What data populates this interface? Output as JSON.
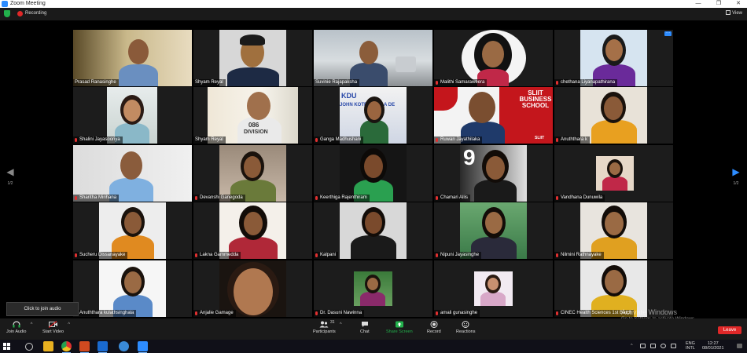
{
  "window": {
    "title": "Zoom Meeting"
  },
  "status": {
    "recording_label": "Recording",
    "view_label": "View"
  },
  "pager": {
    "prev_page": "1/2",
    "next_page": "1/2"
  },
  "participants": [
    {
      "name": "Prasad Ranasinghe"
    },
    {
      "name": "Shyam Reyal"
    },
    {
      "name": "Suvinie Rajapaksha"
    },
    {
      "name": "Malithi Samaraweera"
    },
    {
      "name": "chethana Liyanapathirana"
    },
    {
      "name": "Shalini Jayasooriya"
    },
    {
      "name": "Shyam Reyal"
    },
    {
      "name": "Ganga Madhushani"
    },
    {
      "name": "Ruwan Jayathilaka"
    },
    {
      "name": "Anuththara k"
    },
    {
      "name": "Sharitha Mirihana"
    },
    {
      "name": "Devanshi Ganegoda"
    },
    {
      "name": "Keerthiga Rajenthiram"
    },
    {
      "name": "Chamari Allis"
    },
    {
      "name": "Vandhana Dunuwila"
    },
    {
      "name": "Sucheru Dissanayake"
    },
    {
      "name": "Lakna Gammedda"
    },
    {
      "name": "Kalpani"
    },
    {
      "name": "Nipuni Jayasinghe"
    },
    {
      "name": "Nilmini Rathnayake"
    },
    {
      "name": "Anuththara kulathsinghala"
    },
    {
      "name": "Anjalie Gamage"
    },
    {
      "name": "Dr. Dasuni Nawinna"
    },
    {
      "name": "amali gunasinghe"
    },
    {
      "name": "CINEC Health Sciences 1st Batch"
    }
  ],
  "tile_text": {
    "sliit_line1": "SLIIT",
    "sliit_line2": "BUSINESS",
    "sliit_line3": "SCHOOL",
    "sliit_footer": "SLIIT",
    "kdu_text": "KDU",
    "banner_text": "JOHN KOTELAWALA DE",
    "shirt_text": "086",
    "shirt_text2": "DIVISION",
    "nine": "9"
  },
  "toolbar": {
    "join_audio": "Join Audio",
    "start_video": "Start Video",
    "participants": "Participants",
    "participant_count": "31",
    "chat": "Chat",
    "share_screen": "Share Screen",
    "record": "Record",
    "reactions": "Reactions",
    "leave": "Leave",
    "tooltip": "Click to join audio"
  },
  "watermark": {
    "line1": "Activate Windows",
    "line2": "Go to Settings to activate Windows."
  },
  "taskbar": {
    "lang": "ENG",
    "layout": "INTL",
    "time": "12:27",
    "date": "08/01/2021"
  },
  "colors": {
    "zoom_blue": "#2d8cff",
    "leave_red": "#e02828",
    "share_green": "#22b14c",
    "active_speaker": "#b8e028"
  }
}
